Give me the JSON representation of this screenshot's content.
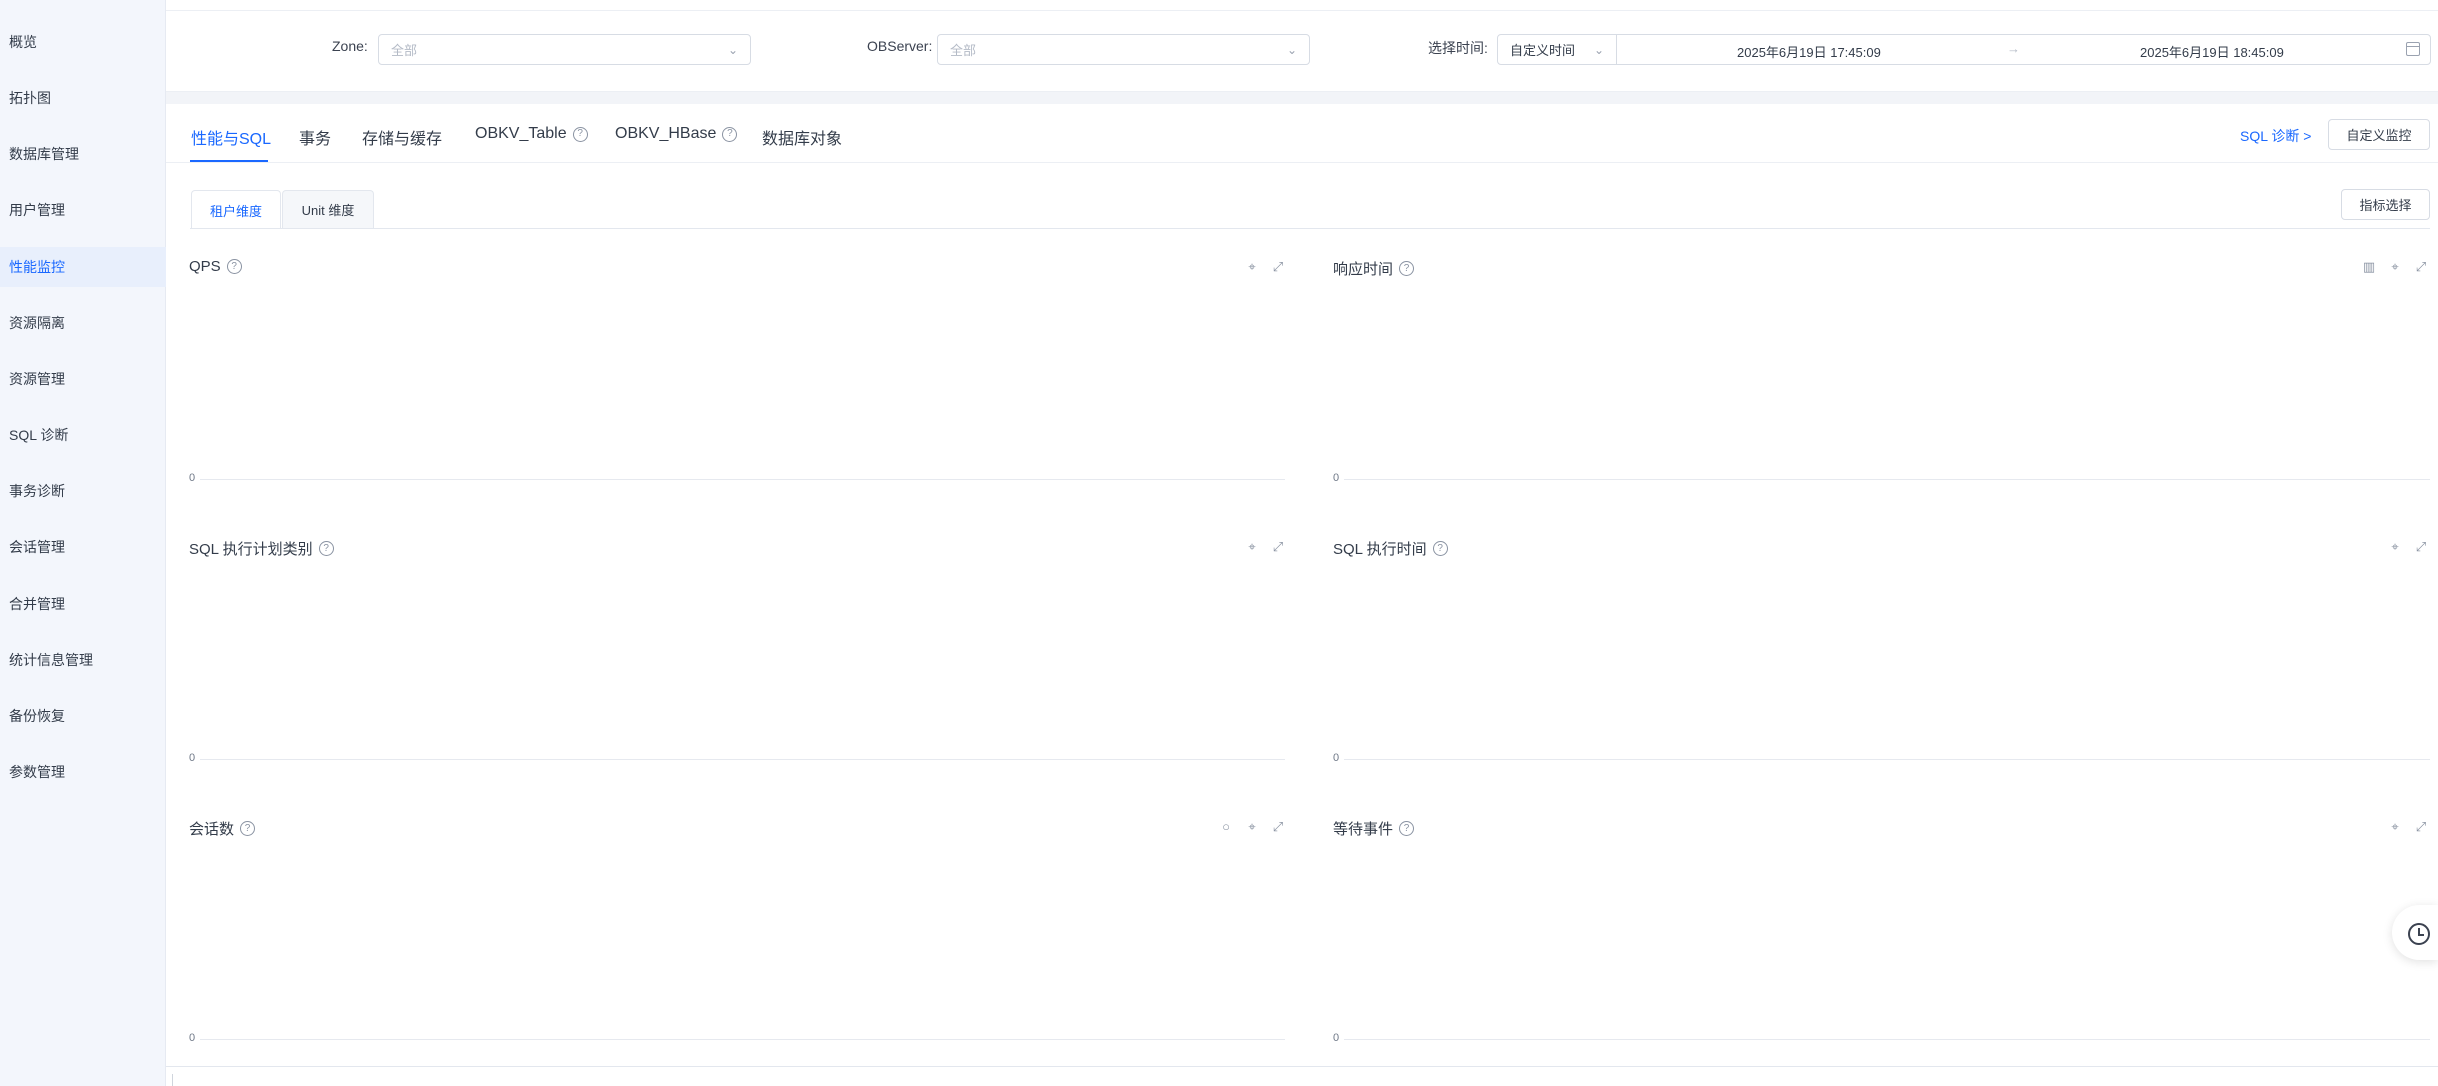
{
  "sidebar": {
    "items": [
      {
        "label": "概览"
      },
      {
        "label": "拓扑图"
      },
      {
        "label": "数据库管理"
      },
      {
        "label": "用户管理"
      },
      {
        "label": "性能监控",
        "active": true
      },
      {
        "label": "资源隔离"
      },
      {
        "label": "资源管理"
      },
      {
        "label": "SQL 诊断"
      },
      {
        "label": "事务诊断"
      },
      {
        "label": "会话管理"
      },
      {
        "label": "合并管理"
      },
      {
        "label": "统计信息管理"
      },
      {
        "label": "备份恢复"
      },
      {
        "label": "参数管理"
      }
    ]
  },
  "filters": {
    "zone_label": "Zone:",
    "zone_value": "全部",
    "observer_label": "OBServer:",
    "observer_value": "全部",
    "time_label": "选择时间:",
    "time_type": "自定义时间",
    "time_start": "2025年6月19日 17:45:09",
    "time_arrow": "→",
    "time_end": "2025年6月19日 18:45:09"
  },
  "tabs": [
    {
      "label": "性能与SQL",
      "active": true
    },
    {
      "label": "事务"
    },
    {
      "label": "存储与缓存"
    },
    {
      "label": "OBKV_Table",
      "help": true
    },
    {
      "label": "OBKV_HBase",
      "help": true
    },
    {
      "label": "数据库对象"
    }
  ],
  "header_actions": {
    "sql_diag_link": "SQL 诊断 >",
    "custom_monitor_button": "自定义监控",
    "metric_select_button": "指标选择"
  },
  "subtabs": [
    {
      "label": "租户维度",
      "active": true
    },
    {
      "label": "Unit 维度"
    }
  ],
  "panels": [
    {
      "title": "QPS",
      "zero": "0"
    },
    {
      "title": "响应时间",
      "zero": "0"
    },
    {
      "title": "SQL 执行计划类别",
      "zero": "0"
    },
    {
      "title": "SQL 执行时间",
      "zero": "0"
    },
    {
      "title": "会话数",
      "zero": "0"
    },
    {
      "title": "等待事件",
      "zero": "0"
    }
  ],
  "icons": {
    "help": "?",
    "pin": "⌖",
    "expand": "⤢",
    "chart": "▥",
    "circle": "○",
    "chevron": "⌄"
  },
  "colors": {
    "accent": "#1a68ff",
    "sidebar_bg": "#f3f6fc",
    "page_bg": "#f2f4f8"
  }
}
